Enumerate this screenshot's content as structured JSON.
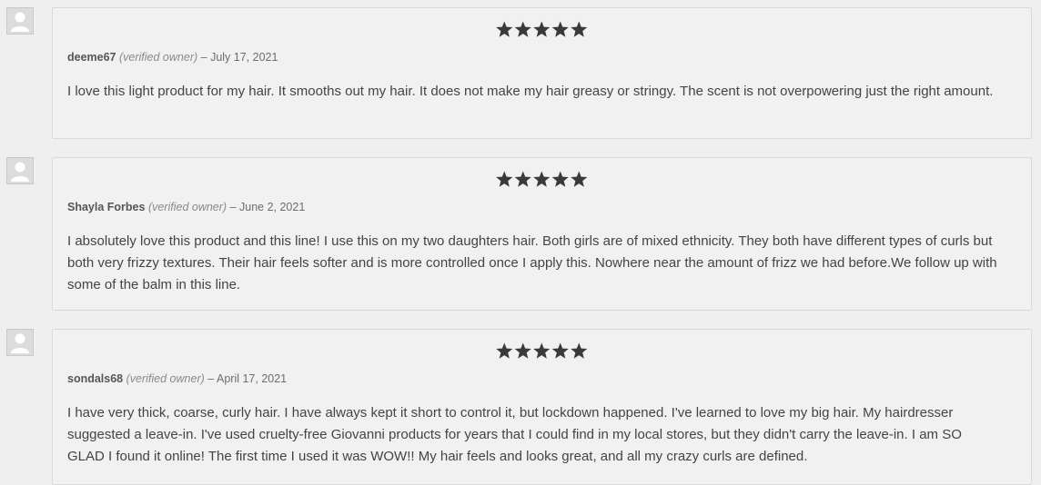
{
  "reviews": [
    {
      "author": "deeme67",
      "verified": "(verified owner)",
      "separator": "–",
      "date": "July 17, 2021",
      "rating": 5,
      "text": "I love this light product for my hair. It smooths out my hair. It does not make my hair greasy or stringy. The scent is not overpowering just the right amount."
    },
    {
      "author": "Shayla Forbes",
      "verified": "(verified owner)",
      "separator": "–",
      "date": "June 2, 2021",
      "rating": 5,
      "text": "I absolutely love this product and this line! I use this on my two daughters hair. Both girls are of mixed ethnicity. They both have different types of curls but both very frizzy textures. Their hair feels softer and is more controlled once I apply this. Nowhere near the amount of frizz we had before.We follow up with some of the balm in this line."
    },
    {
      "author": "sondals68",
      "verified": "(verified owner)",
      "separator": "–",
      "date": "April 17, 2021",
      "rating": 5,
      "text": "I have very thick, coarse, curly hair. I have always kept it short to control it, but lockdown happened. I've learned to love my big hair. My hairdresser suggested a leave-in. I've used cruelty-free Giovanni products for years that I could find in my local stores, but they didn't carry the leave-in. I am SO GLAD I found it online! The first time I used it was WOW!! My hair feels and looks great, and all my crazy curls are defined."
    }
  ],
  "icons": {
    "avatar": "default-user-avatar-icon",
    "star": "star-icon"
  },
  "colors": {
    "page_bg": "#efefef",
    "card_bg": "#f1f1f1",
    "star": "#3a3a3a"
  }
}
